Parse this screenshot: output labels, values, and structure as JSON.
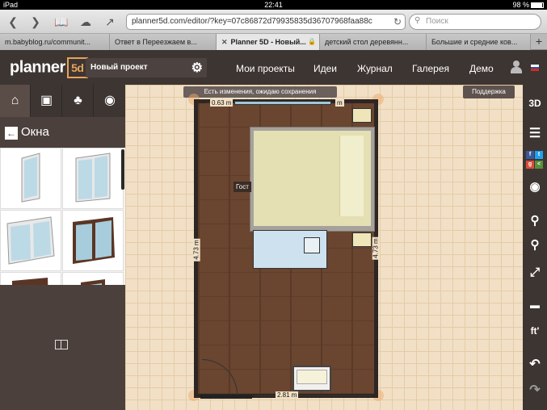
{
  "status": {
    "device": "iPad",
    "time": "22:41",
    "battery": "98 %"
  },
  "browser": {
    "url": "planner5d.com/editor/?key=07c86872d79935835d36707968faa88c",
    "search_placeholder": "Поиск",
    "tabs": [
      {
        "label": "m.babyblog.ru/communit..."
      },
      {
        "label": "Ответ в Переезжаем в..."
      },
      {
        "label": "Planner 5D - Новый...",
        "active": true
      },
      {
        "label": "детский стол деревянн..."
      },
      {
        "label": "Большие и средние ков..."
      }
    ]
  },
  "app": {
    "logo_text": "planner",
    "logo_mark": "5d",
    "project_name": "Новый проект",
    "nav": [
      "Мои проекты",
      "Идеи",
      "Журнал",
      "Галерея",
      "Демо"
    ],
    "save_status": "Есть изменения, ожидаю сохранения",
    "support_label": "Поддержка"
  },
  "catalog": {
    "section_title": "Окна",
    "categories": [
      "home-icon",
      "furniture-icon",
      "tree-icon",
      "eye-icon"
    ]
  },
  "plan": {
    "top_dimension": "0.63 m",
    "top_dimension_end": "m",
    "bottom_dimension": "2.81 m",
    "left_dimension": "4.73 m",
    "right_dimension": "4.73 m",
    "room_label": "Гост"
  },
  "right_tools": {
    "view3d": "3D",
    "units": "ft'"
  },
  "colors": {
    "header": "#3d3532",
    "panel": "#4b403c",
    "canvas": "#f1e0c6",
    "accent": "#e8a35a"
  }
}
